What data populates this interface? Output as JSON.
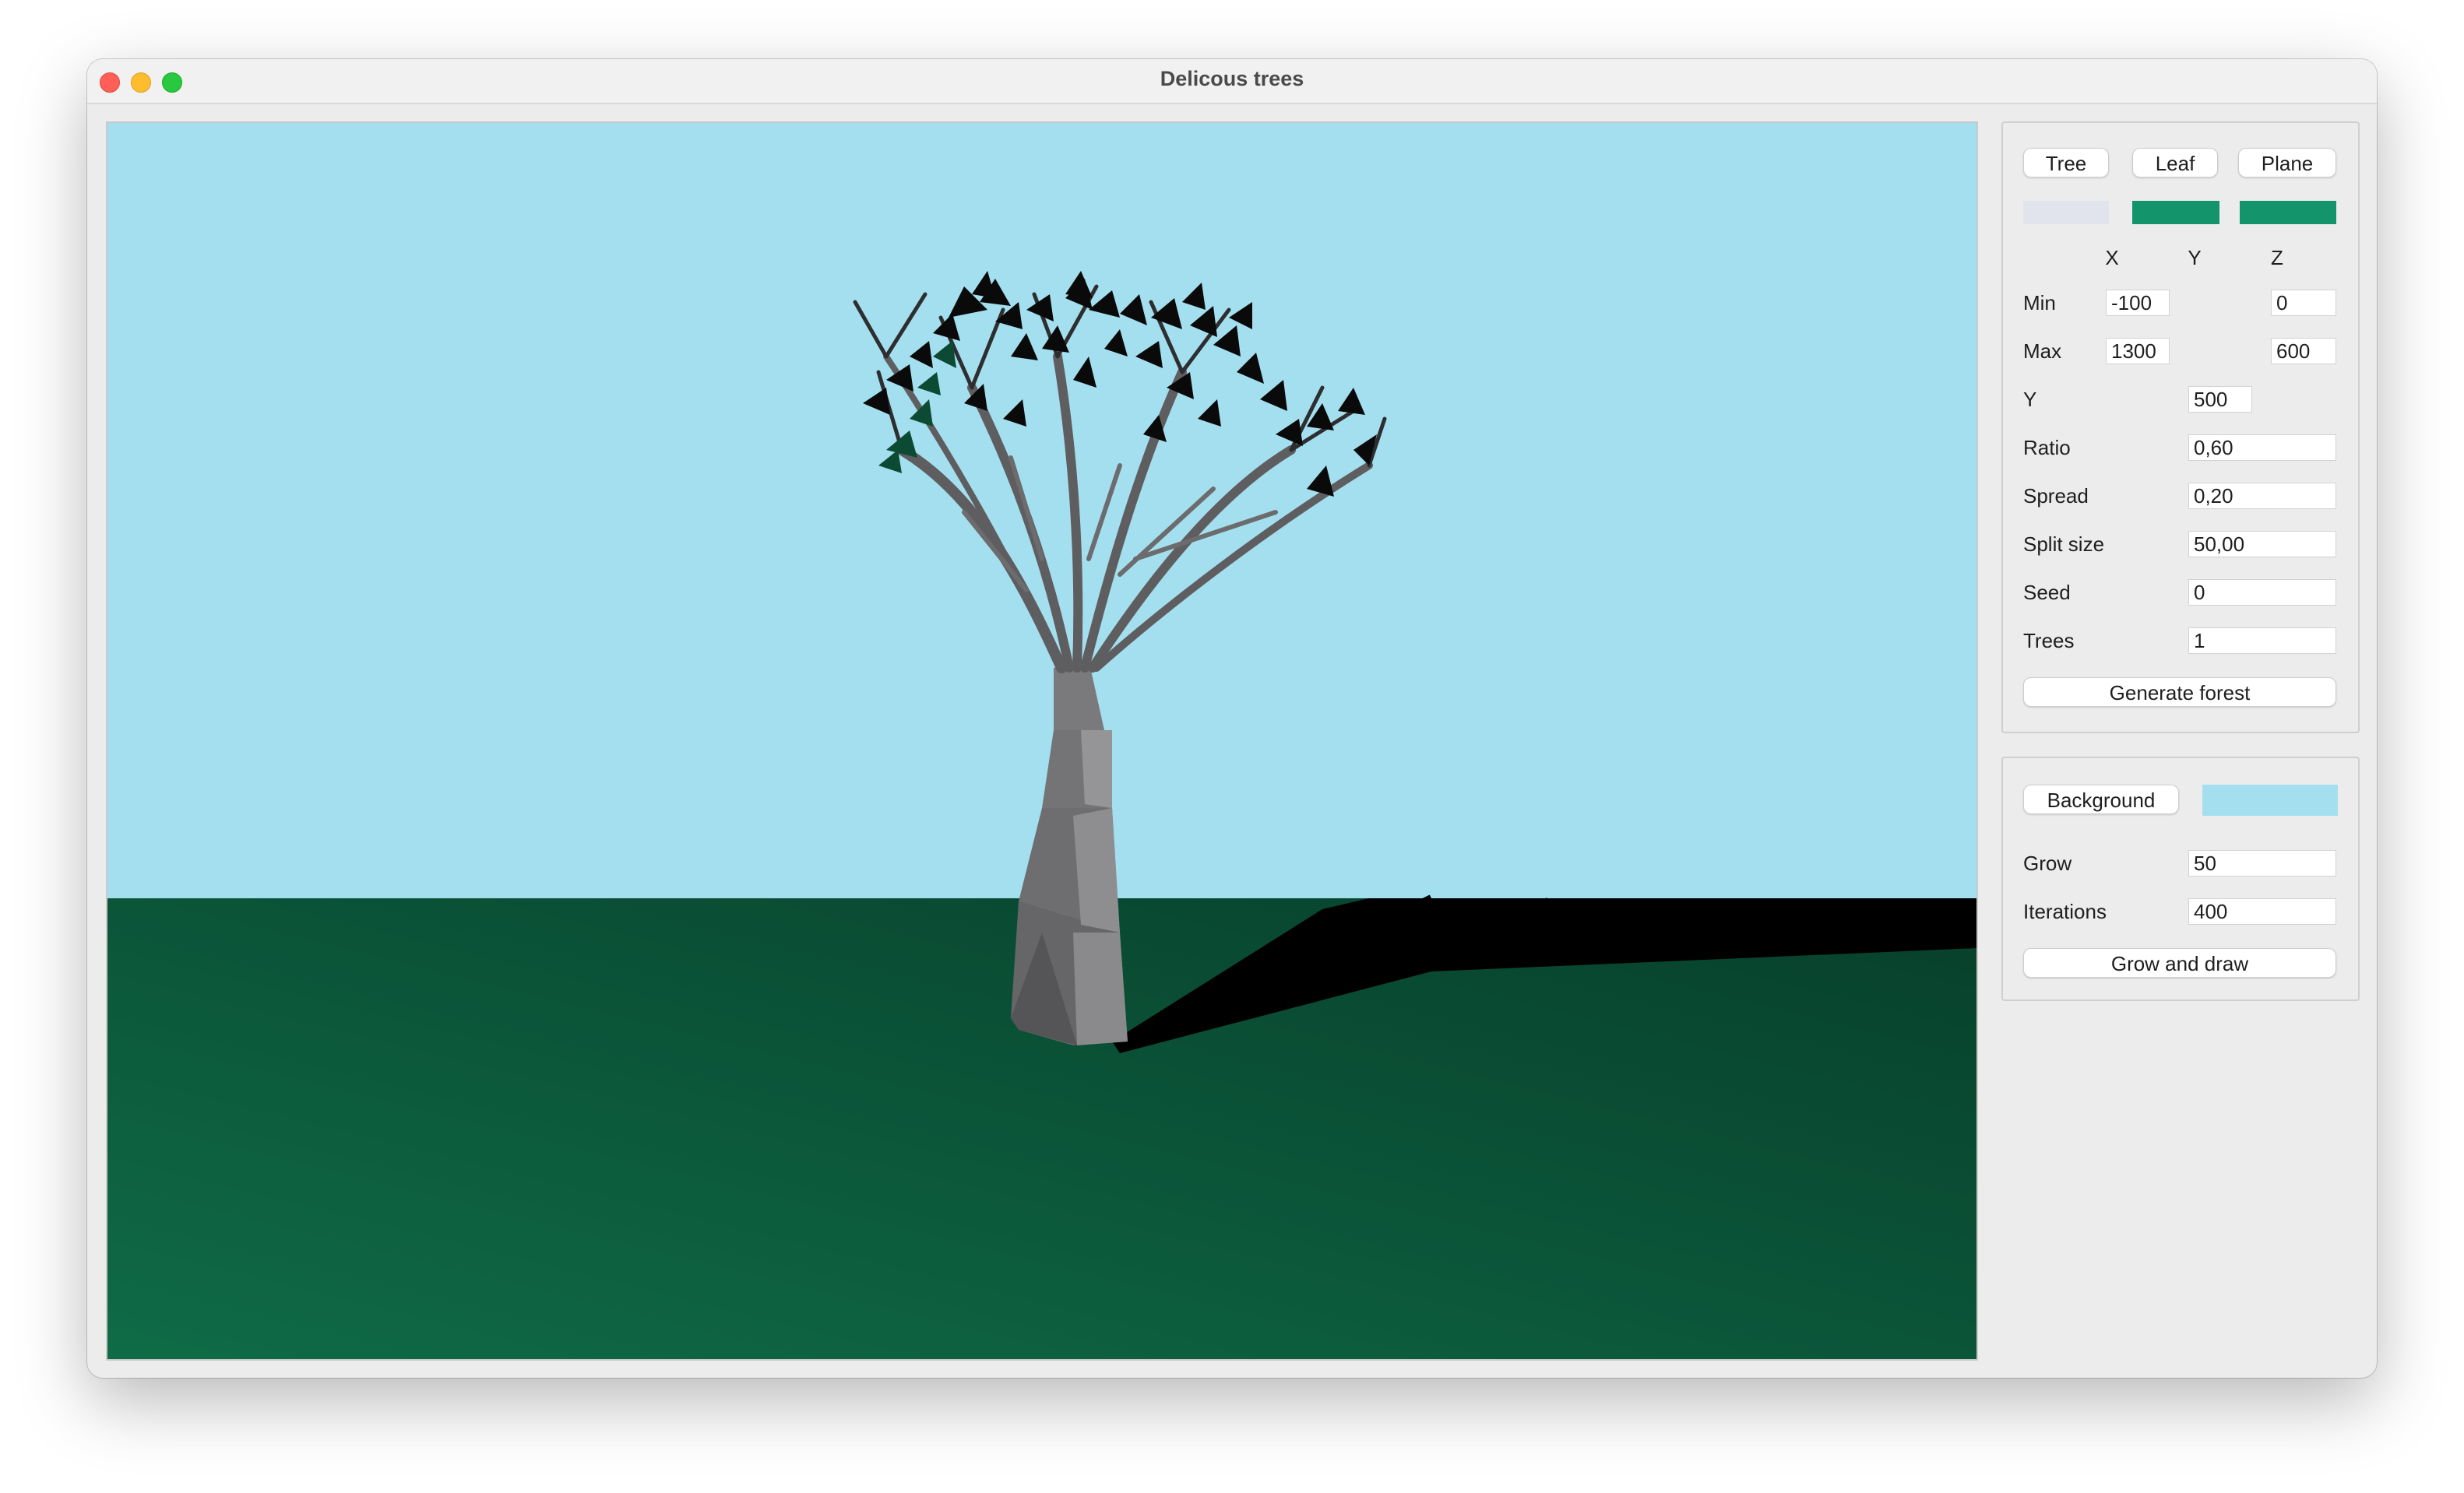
{
  "window": {
    "title": "Delicous trees"
  },
  "colors": {
    "sky": "#a4dfef",
    "plane_near": "#0f6b47",
    "plane_far": "#0a4a33",
    "trunk": "#7a7a7c",
    "leaf": "#0e8f5c",
    "tree_swatch": "#e1e4ec",
    "leaf_swatch": "#14946a",
    "plane_swatch": "#14946a",
    "background_swatch": "#a4dfef"
  },
  "color_buttons": {
    "tree": "Tree",
    "leaf": "Leaf",
    "plane": "Plane"
  },
  "axis_headers": {
    "x": "X",
    "y": "Y",
    "z": "Z"
  },
  "min": {
    "label": "Min",
    "x": "-100",
    "z": "0"
  },
  "max": {
    "label": "Max",
    "x": "1300",
    "z": "600"
  },
  "params": {
    "y": {
      "label": "Y",
      "value": "500"
    },
    "ratio": {
      "label": "Ratio",
      "value": "0,60"
    },
    "spread": {
      "label": "Spread",
      "value": "0,20"
    },
    "split_size": {
      "label": "Split size",
      "value": "50,00"
    },
    "seed": {
      "label": "Seed",
      "value": "0"
    },
    "trees": {
      "label": "Trees",
      "value": "1"
    }
  },
  "generate_button": "Generate forest",
  "background_button": "Background",
  "grow": {
    "label": "Grow",
    "value": "50"
  },
  "iterations": {
    "label": "Iterations",
    "value": "400"
  },
  "grow_draw_button": "Grow and draw"
}
